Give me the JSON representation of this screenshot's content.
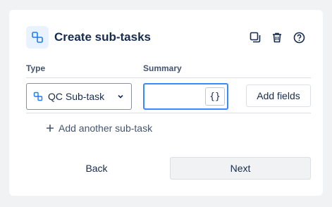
{
  "dialog": {
    "title": "Create sub-tasks",
    "header_icon": "subtask-icon",
    "actions": [
      {
        "name": "copy-icon"
      },
      {
        "name": "trash-icon"
      },
      {
        "name": "help-icon"
      }
    ]
  },
  "table": {
    "columns": {
      "type": "Type",
      "summary": "Summary"
    },
    "row": {
      "type_value": "QC Sub-task",
      "type_icon": "subtask-icon",
      "summary_value": "",
      "braces_label": "{}",
      "add_fields_label": "Add fields"
    }
  },
  "add_another_label": "Add another sub-task",
  "footer": {
    "back_label": "Back",
    "next_label": "Next"
  },
  "colors": {
    "accent": "#388bff",
    "icon_blue": "#1d7afc",
    "text": "#172b4d"
  }
}
